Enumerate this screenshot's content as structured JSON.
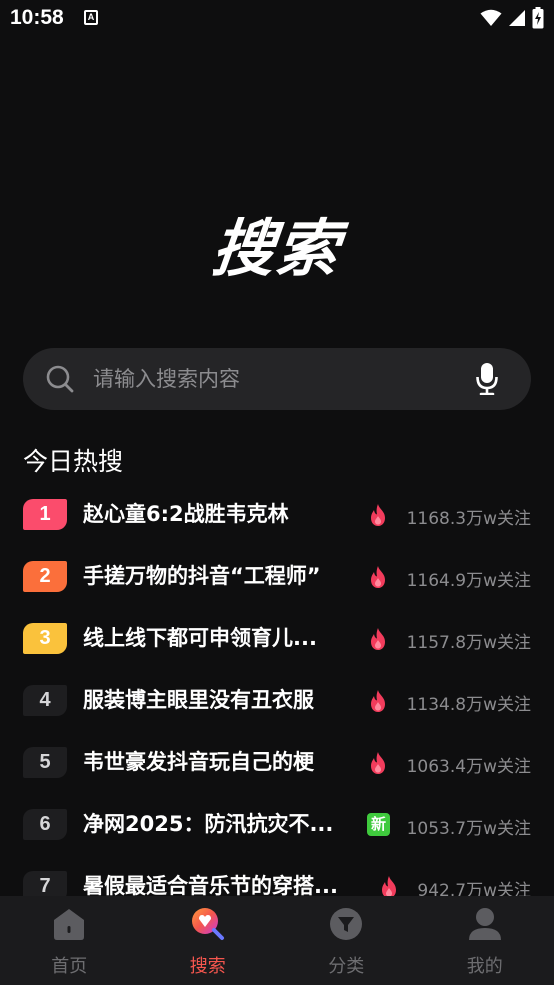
{
  "status_bar": {
    "time": "10:58",
    "notification_letter": "A"
  },
  "page": {
    "title": "搜索"
  },
  "search": {
    "placeholder": "请输入搜索内容",
    "value": ""
  },
  "hot_section": {
    "title": "今日热搜",
    "items": [
      {
        "rank": "1",
        "title": "赵心童6:2战胜韦克林",
        "badge": "hot",
        "count": "1168.3万w关注"
      },
      {
        "rank": "2",
        "title": "手搓万物的抖音“工程师”",
        "badge": "hot",
        "count": "1164.9万w关注"
      },
      {
        "rank": "3",
        "title": "线上线下都可申领育儿...",
        "badge": "hot",
        "count": "1157.8万w关注"
      },
      {
        "rank": "4",
        "title": "服装博主眼里没有丑衣服",
        "badge": "hot",
        "count": "1134.8万w关注"
      },
      {
        "rank": "5",
        "title": "韦世豪发抖音玩自己的梗",
        "badge": "hot",
        "count": "1063.4万w关注"
      },
      {
        "rank": "6",
        "title": "净网2025：防汛抗灾不...",
        "badge": "new",
        "badge_text": "新",
        "count": "1053.7万w关注"
      },
      {
        "rank": "7",
        "title": "暑假最适合音乐节的穿搭...",
        "badge": "hot",
        "count": "942.7万w关注"
      }
    ]
  },
  "tab_bar": {
    "tabs": [
      {
        "label": "首页",
        "icon": "home-icon",
        "active": false
      },
      {
        "label": "搜索",
        "icon": "search-tab-icon",
        "active": true
      },
      {
        "label": "分类",
        "icon": "category-icon",
        "active": false
      },
      {
        "label": "我的",
        "icon": "profile-icon",
        "active": false
      }
    ]
  },
  "colors": {
    "background": "#0e0e0f",
    "rank1": "#fb4c6c",
    "rank2": "#fb6f3b",
    "rank3": "#fac23c",
    "accent": "#f4564e",
    "new_badge": "#3fca3d"
  }
}
